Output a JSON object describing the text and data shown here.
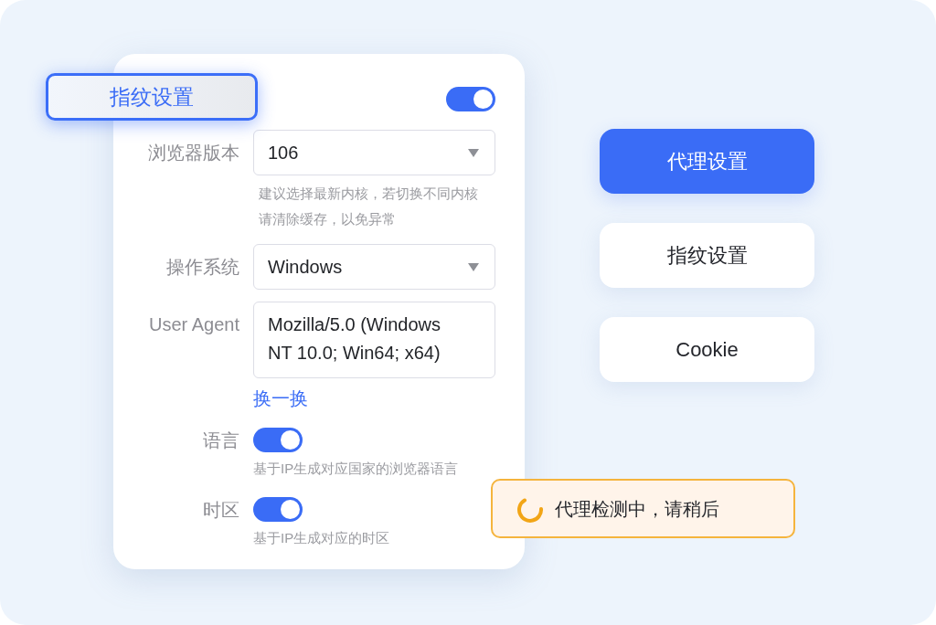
{
  "settings_card": {
    "title": "指纹设置",
    "enabled": true,
    "fields": [
      {
        "kind": "select",
        "label": "浏览器版本",
        "value": "106",
        "hint": "建议选择最新内核，若切换不同内核请清除缓存，以免异常"
      },
      {
        "kind": "select",
        "label": "操作系统",
        "value": "Windows"
      },
      {
        "kind": "textarea",
        "label": "User Agent",
        "value": "Mozilla/5.0 (Windows NT 10.0; Win64; x64)",
        "link": "换一换"
      },
      {
        "kind": "toggle",
        "label": "语言",
        "on": true,
        "hint": "基于IP生成对应国家的浏览器语言"
      },
      {
        "kind": "toggle",
        "label": "时区",
        "on": true,
        "hint": "基于IP生成对应的时区"
      }
    ]
  },
  "menu": [
    {
      "label": "代理设置",
      "selected": true
    },
    {
      "label": "指纹设置",
      "selected": false
    },
    {
      "label": "Cookie",
      "selected": false
    }
  ],
  "toast": {
    "text": "代理检测中，请稍后"
  }
}
